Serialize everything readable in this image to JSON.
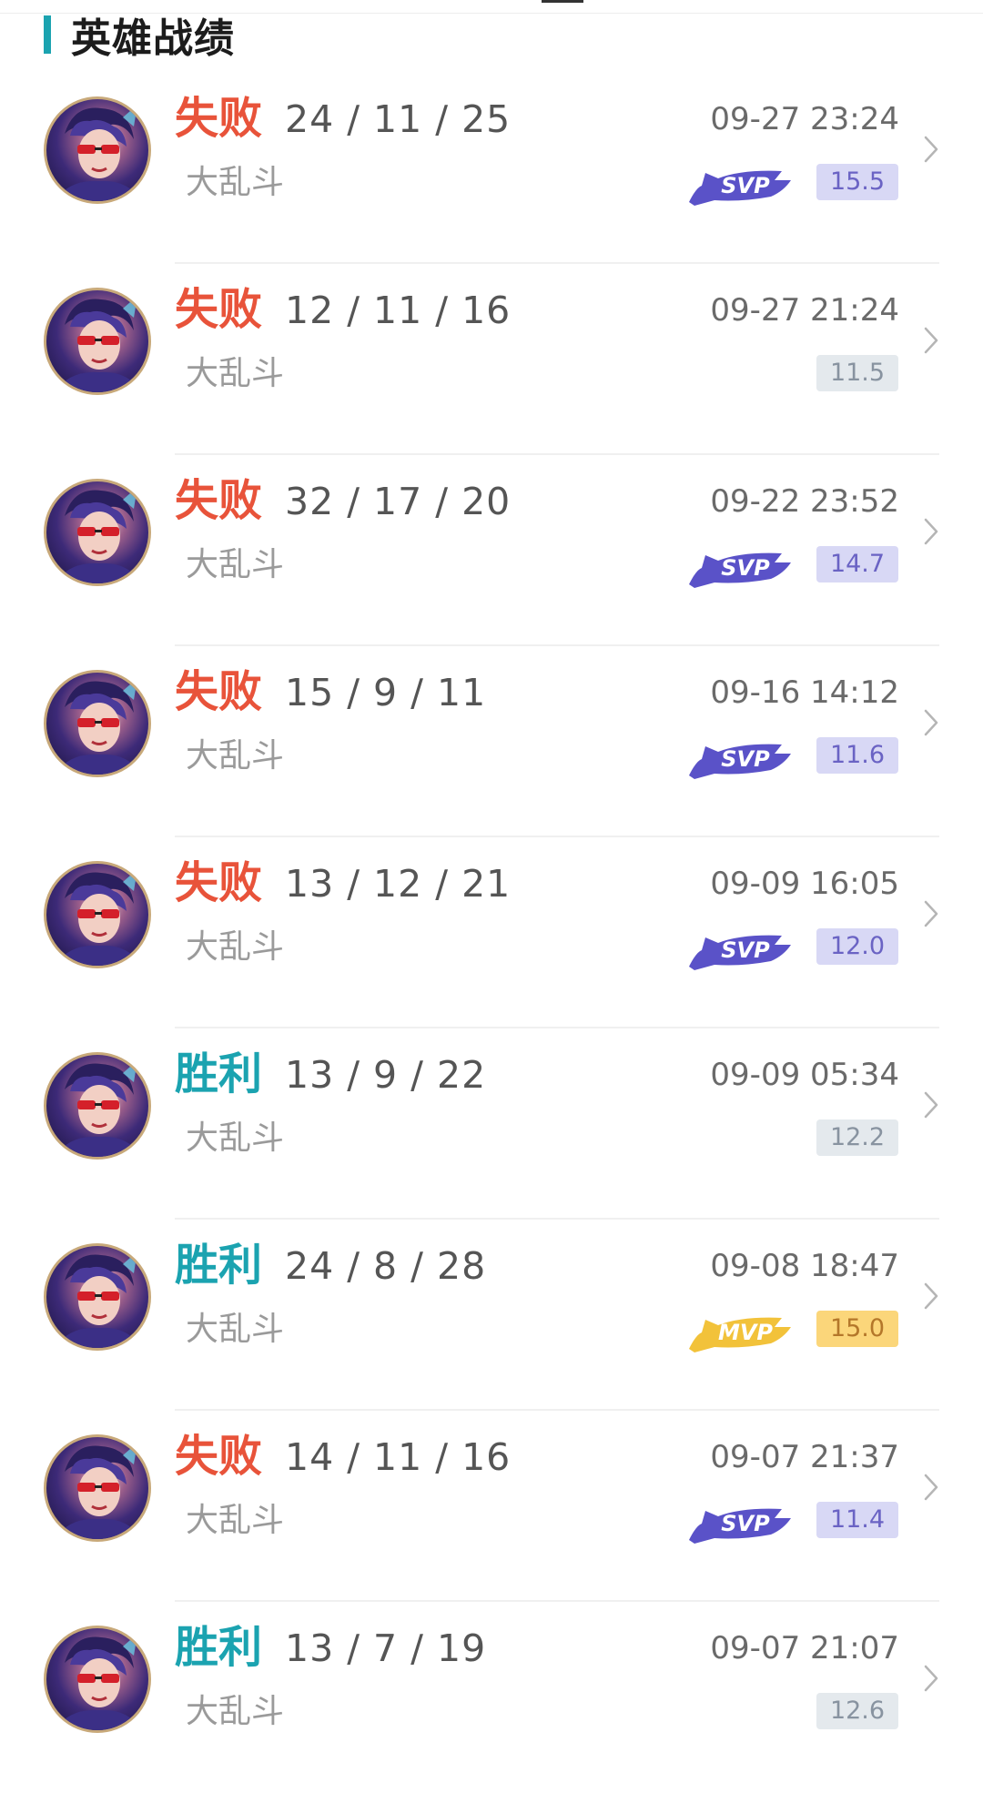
{
  "header": {
    "title": "英雄战绩"
  },
  "matches": [
    {
      "result": "失败",
      "outcome": "loss",
      "kda": "24 / 11 / 25",
      "mode": "大乱斗",
      "time": "09-27 23:24",
      "badge": "SVP",
      "score": "15.5"
    },
    {
      "result": "失败",
      "outcome": "loss",
      "kda": "12 / 11 / 16",
      "mode": "大乱斗",
      "time": "09-27 21:24",
      "badge": "",
      "score": "11.5"
    },
    {
      "result": "失败",
      "outcome": "loss",
      "kda": "32 / 17 / 20",
      "mode": "大乱斗",
      "time": "09-22 23:52",
      "badge": "SVP",
      "score": "14.7"
    },
    {
      "result": "失败",
      "outcome": "loss",
      "kda": "15 / 9 / 11",
      "mode": "大乱斗",
      "time": "09-16 14:12",
      "badge": "SVP",
      "score": "11.6"
    },
    {
      "result": "失败",
      "outcome": "loss",
      "kda": "13 / 12 / 21",
      "mode": "大乱斗",
      "time": "09-09 16:05",
      "badge": "SVP",
      "score": "12.0"
    },
    {
      "result": "胜利",
      "outcome": "win",
      "kda": "13 / 9 / 22",
      "mode": "大乱斗",
      "time": "09-09 05:34",
      "badge": "",
      "score": "12.2"
    },
    {
      "result": "胜利",
      "outcome": "win",
      "kda": "24 / 8 / 28",
      "mode": "大乱斗",
      "time": "09-08 18:47",
      "badge": "MVP",
      "score": "15.0"
    },
    {
      "result": "失败",
      "outcome": "loss",
      "kda": "14 / 11 / 16",
      "mode": "大乱斗",
      "time": "09-07 21:37",
      "badge": "SVP",
      "score": "11.4"
    },
    {
      "result": "胜利",
      "outcome": "win",
      "kda": "13 / 7 / 19",
      "mode": "大乱斗",
      "time": "09-07 21:07",
      "badge": "",
      "score": "12.6"
    }
  ],
  "colors": {
    "accent": "#1ba3b0",
    "loss": "#e8533a",
    "win": "#1ba3b0",
    "svp_badge": "#5a52c8",
    "mvp_badge": "#f2c23a"
  },
  "icons": {
    "avatar": "hero-avatar-icon",
    "chevron": "chevron-right-icon",
    "svp": "svp-badge-icon",
    "mvp": "mvp-badge-icon"
  }
}
